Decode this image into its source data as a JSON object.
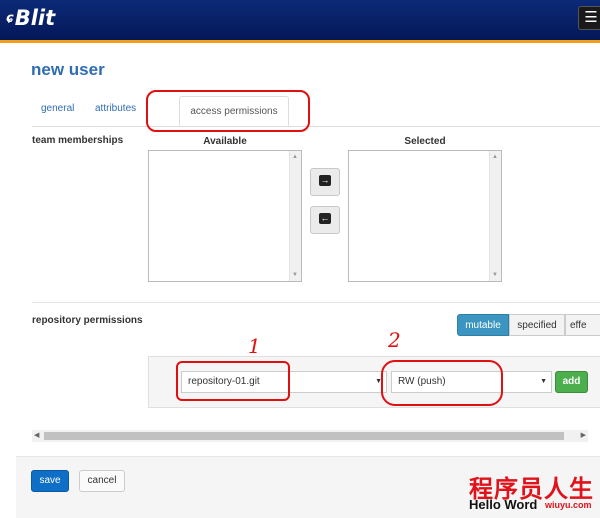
{
  "app": {
    "brand": "Blit",
    "brand_mark": "ɕ"
  },
  "header": {
    "menu_icon": "☰"
  },
  "page": {
    "title": "new user"
  },
  "tabs": [
    {
      "label": "general"
    },
    {
      "label": "attributes"
    },
    {
      "label": "access permissions",
      "active": true
    }
  ],
  "team_memberships": {
    "label": "team memberships",
    "available_label": "Available",
    "selected_label": "Selected",
    "move_right_icon": "arrow-right-icon",
    "move_left_icon": "arrow-left-icon"
  },
  "repository_permissions": {
    "label": "repository permissions",
    "modes": [
      "mutable",
      "specified",
      "effe"
    ],
    "active_mode": "mutable",
    "repository_value": "repository-01.git",
    "permission_value": "RW (push)",
    "add_label": "add"
  },
  "annotations": {
    "mark1": "1",
    "mark2": "2"
  },
  "footer": {
    "save_label": "save",
    "cancel_label": "cancel"
  },
  "watermark": {
    "cn": "程序员人生",
    "en": "Hello Word",
    "site": "wiuyu.com"
  },
  "colors": {
    "navbar": "#0c2a78",
    "accent": "#f29e1a",
    "link": "#2f6db3",
    "primary": "#0f6fc6",
    "success": "#4cae4c",
    "annotation": "#e01010"
  }
}
